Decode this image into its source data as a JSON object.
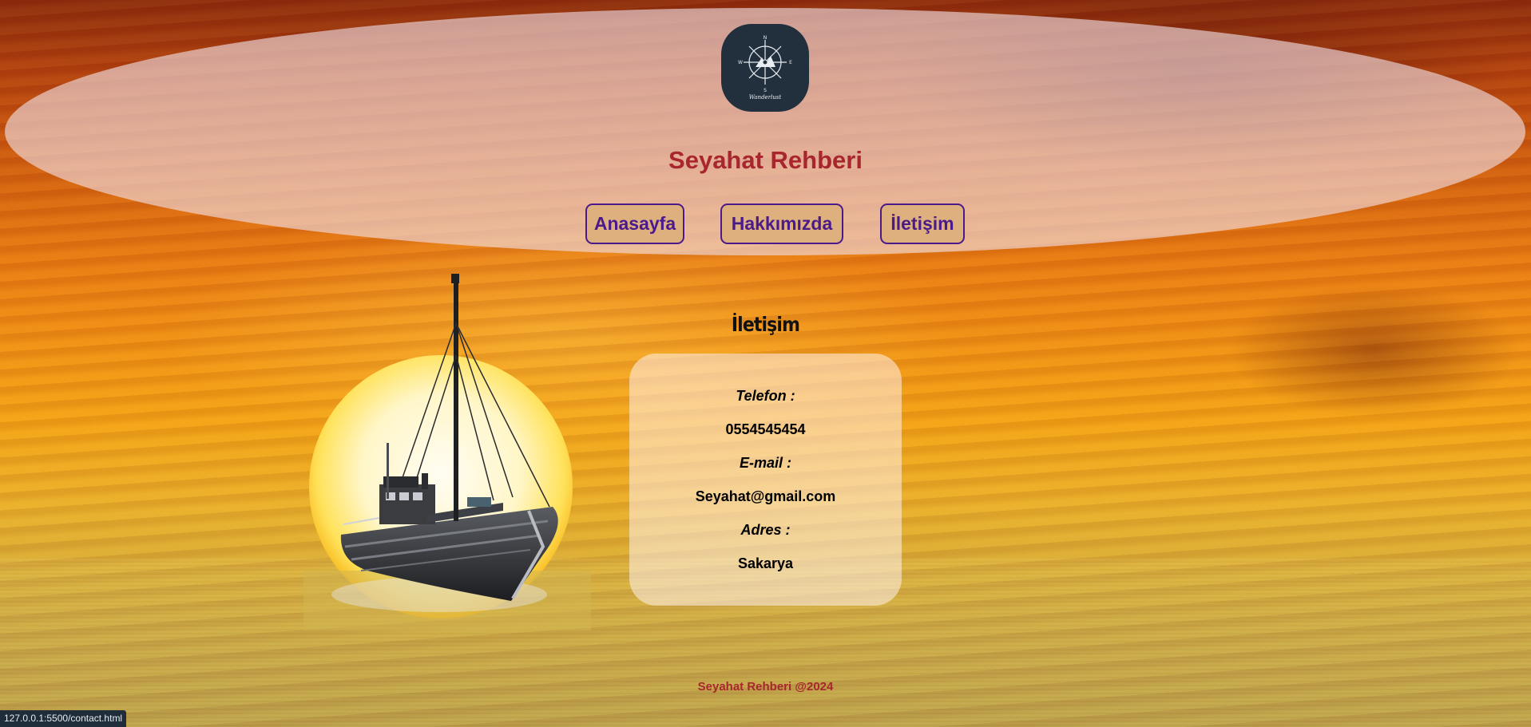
{
  "header": {
    "logo_icon": "compass-logo-icon",
    "logo_text": "Wanderlust",
    "site_title": "Seyahat Rehberi"
  },
  "nav": {
    "home": "Anasayfa",
    "about": "Hakkımızda",
    "contact": "İletişim"
  },
  "contact": {
    "title": "İletişim",
    "phone_label": "Telefon :",
    "phone_value": "0554545454",
    "email_label": "E-mail :",
    "email_value": "Seyahat@gmail.com",
    "address_label": "Adres :",
    "address_value": "Sakarya"
  },
  "footer": {
    "text": "Seyahat Rehberi @2024"
  },
  "status_bar": {
    "url": "127.0.0.1:5500/contact.html"
  },
  "colors": {
    "title_red": "#a8262d",
    "nav_purple": "#4a1a8a",
    "nav_fill": "#deb07e",
    "logo_bg": "#22303d"
  }
}
